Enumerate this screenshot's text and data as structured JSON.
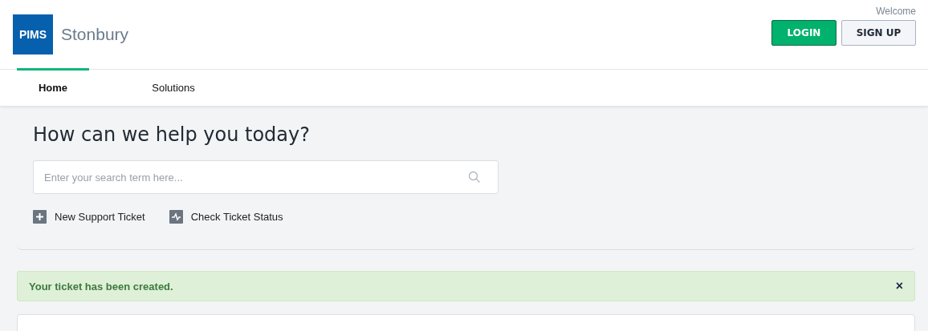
{
  "header": {
    "logo": "PIMS",
    "brand": "Stonbury",
    "welcome": "Welcome",
    "buttons": [
      {
        "label": "LOGIN",
        "kind": "primary"
      },
      {
        "label": "SIGN UP",
        "kind": "secondary"
      }
    ]
  },
  "tabs": [
    {
      "label": "Home",
      "selected": true
    },
    {
      "label": "Solutions",
      "selected": false
    }
  ],
  "hero": {
    "title": "How can we help you today?",
    "search": {
      "placeholder": "Enter your search term here..."
    },
    "actions": [
      {
        "label": "New Support Ticket",
        "kind": "plus"
      },
      {
        "label": "Check Ticket Status",
        "kind": "pulse"
      }
    ]
  },
  "alert": {
    "message": "Your ticket has been created.",
    "close": "×"
  }
}
